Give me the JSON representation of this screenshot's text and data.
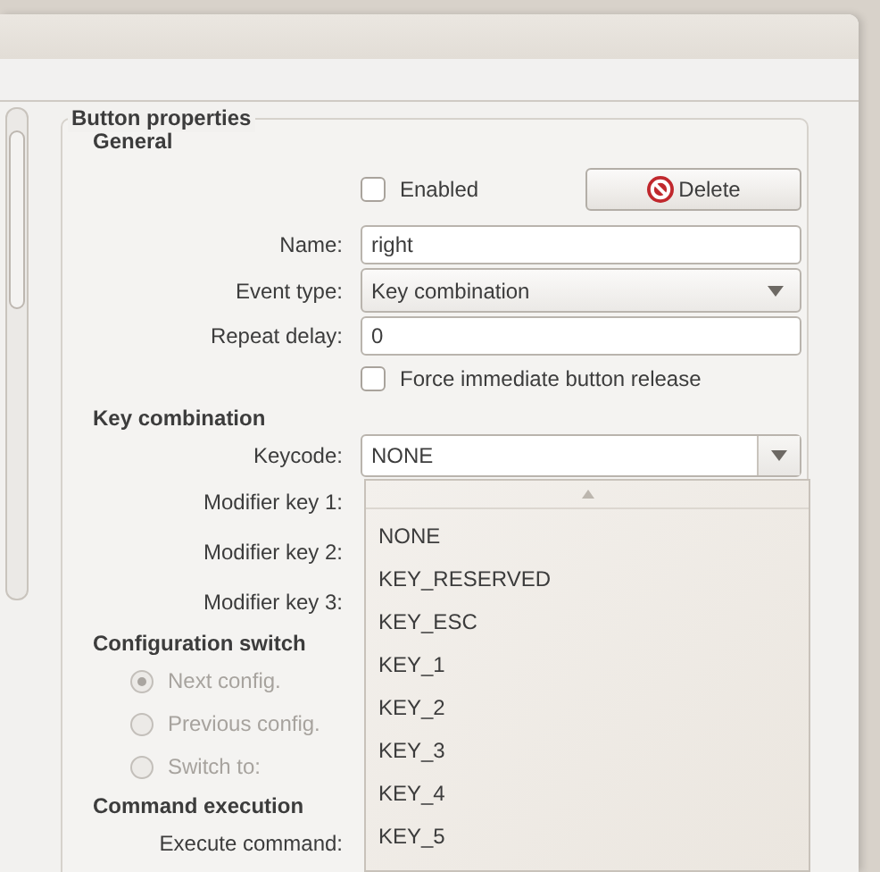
{
  "frame_title": "Button properties",
  "general": {
    "heading": "General",
    "enabled": {
      "label": "Enabled",
      "checked": false
    },
    "delete_button": "Delete",
    "name": {
      "label": "Name:",
      "value": "right"
    },
    "event_type": {
      "label": "Event type:",
      "value": "Key combination"
    },
    "repeat_delay": {
      "label": "Repeat delay:",
      "value": "0"
    },
    "force_release": {
      "label": "Force immediate button release",
      "checked": false
    }
  },
  "key_combination": {
    "heading": "Key combination",
    "keycode": {
      "label": "Keycode:",
      "value": "NONE"
    },
    "modifiers": [
      {
        "label": "Modifier key 1:"
      },
      {
        "label": "Modifier key 2:"
      },
      {
        "label": "Modifier key 3:"
      }
    ]
  },
  "config_switch": {
    "heading": "Configuration switch",
    "disabled": true,
    "options": [
      {
        "label": "Next config.",
        "selected": true
      },
      {
        "label": "Previous config.",
        "selected": false
      },
      {
        "label": "Switch to:",
        "selected": false
      }
    ]
  },
  "command_execution": {
    "heading": "Command execution",
    "label": "Execute command:"
  },
  "keycode_menu": {
    "items": [
      {
        "label": "NONE"
      },
      {
        "label": "KEY_RESERVED"
      },
      {
        "label": "KEY_ESC"
      },
      {
        "label": "KEY_1"
      },
      {
        "label": "KEY_2"
      },
      {
        "label": "KEY_3"
      },
      {
        "label": "KEY_4"
      },
      {
        "label": "KEY_5"
      }
    ]
  }
}
